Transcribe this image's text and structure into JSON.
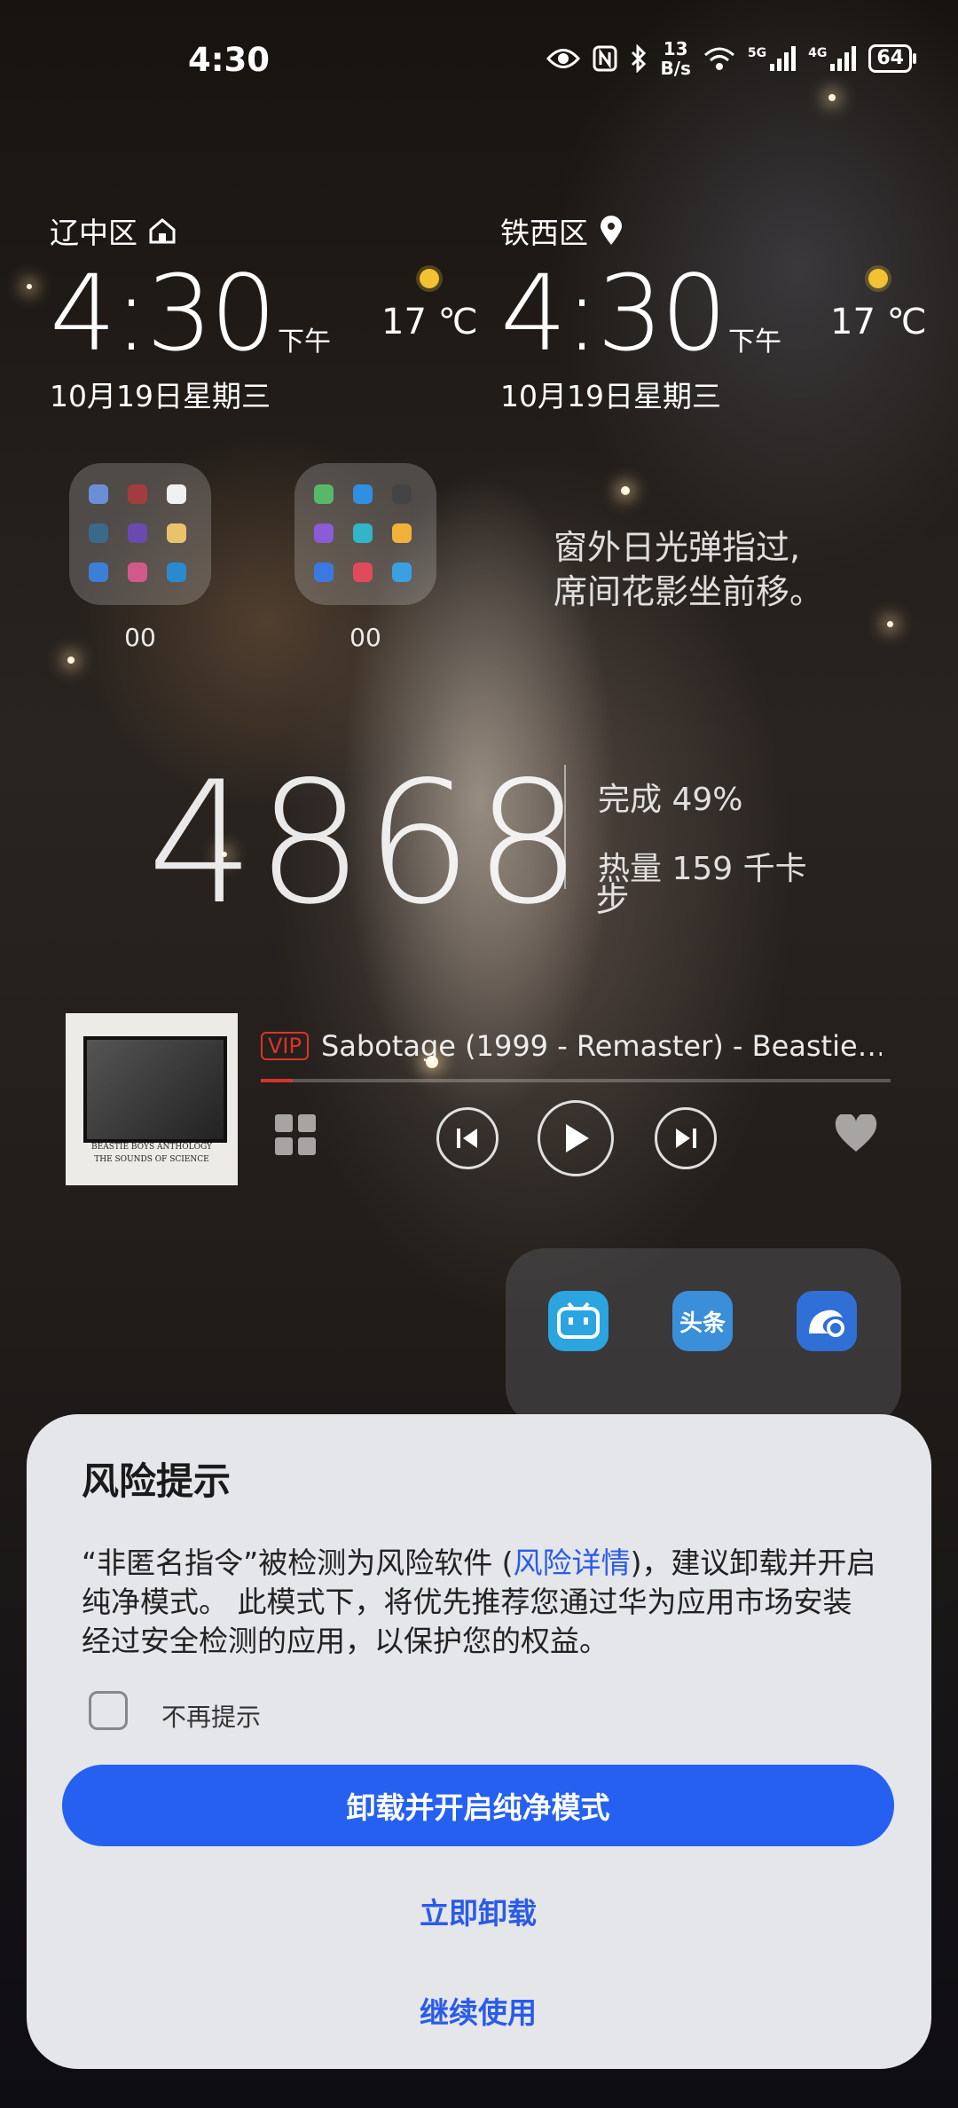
{
  "status_bar": {
    "time": "4:30",
    "speed_top": "13",
    "speed_unit": "B/s",
    "net1": "5G",
    "net2": "4G",
    "battery": "64"
  },
  "clock_widgets": [
    {
      "city": "辽中区",
      "time": "4:30",
      "ampm": "下午",
      "date": "10月19日星期三",
      "temp": "17 ℃",
      "city_icon": "home-icon"
    },
    {
      "city": "铁西区",
      "time": "4:30",
      "ampm": "下午",
      "date": "10月19日星期三",
      "temp": "17 ℃",
      "city_icon": "location-pin-icon"
    }
  ],
  "folders": [
    {
      "label": "00"
    },
    {
      "label": "00"
    }
  ],
  "quote": {
    "line1": "窗外日光弹指过,",
    "line2": "席间花影坐前移。"
  },
  "steps": {
    "count": "4868",
    "unit": "步",
    "completion": "完成 49%",
    "calories": "热量 159 千卡"
  },
  "music": {
    "vip": "VIP",
    "title": "Sabotage (1999 - Remaster) - Beastie…",
    "cover_line1": "BEASTIE BOYS ANTHOLOGY",
    "cover_line2": "THE SOUNDS OF SCIENCE",
    "progress": 0.05
  },
  "dock": [
    {
      "icon": "bilibili-icon",
      "label": ""
    },
    {
      "icon": "toutiao-icon",
      "label": "头条"
    },
    {
      "icon": "uc-browser-icon",
      "label": ""
    }
  ],
  "dialog": {
    "title": "风险提示",
    "body_pre": "“非匿名指令”被检测为风险软件 (",
    "body_link": "风险详情",
    "body_post": ")，建议卸载并开启纯净模式。 此模式下，将优先推荐您通过华为应用市场安装经过安全检测的应用，以保护您的权益。",
    "checkbox_label": "不再提示",
    "primary_button": "卸载并开启纯净模式",
    "uninstall_button": "立即卸载",
    "continue_button": "继续使用"
  },
  "colors": {
    "accent": "#2660f0",
    "link": "#2a5be8",
    "vip": "#d9342b",
    "sun": "#f2c233"
  }
}
